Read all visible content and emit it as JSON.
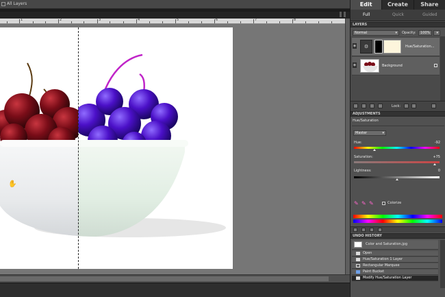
{
  "top": {
    "all_layers_label": "All Layers"
  },
  "ruler": {
    "marks": [
      "1",
      "2",
      "3",
      "4",
      "5",
      "6",
      "7",
      "8"
    ]
  },
  "panel": {
    "mode_tabs": [
      "Edit",
      "Create",
      "Share"
    ],
    "sub_tabs": [
      "Full",
      "Quick",
      "Guided"
    ]
  },
  "layers": {
    "title": "LAYERS",
    "blend_mode": "Normal",
    "opacity_label": "Opacity:",
    "opacity_value": "100%",
    "items": [
      {
        "name": "Hue/Saturation..."
      },
      {
        "name": "Background"
      }
    ],
    "lock_label": "Lock:"
  },
  "adjustments": {
    "title": "ADJUSTMENTS",
    "adjustment_name": "Hue/Saturation",
    "channel": "Master",
    "hue": {
      "label": "Hue:",
      "value": "-92",
      "level": 0.24
    },
    "saturation": {
      "label": "Saturation:",
      "value": "+75",
      "level": 0.94
    },
    "lightness": {
      "label": "Lightness:",
      "value": "0",
      "level": 0.5
    },
    "colorize_label": "Colorize"
  },
  "history": {
    "title": "UNDO HISTORY",
    "source": "Color and Saturation.jpg",
    "items": [
      "Open",
      "Hue/Saturation 1 Layer",
      "Rectangular Marquee",
      "Paint Bucket",
      "Modify Hue/Saturation Layer"
    ]
  },
  "colors": {
    "accent_purple": "#4b10c8",
    "cherry_red": "#7a0d18"
  }
}
